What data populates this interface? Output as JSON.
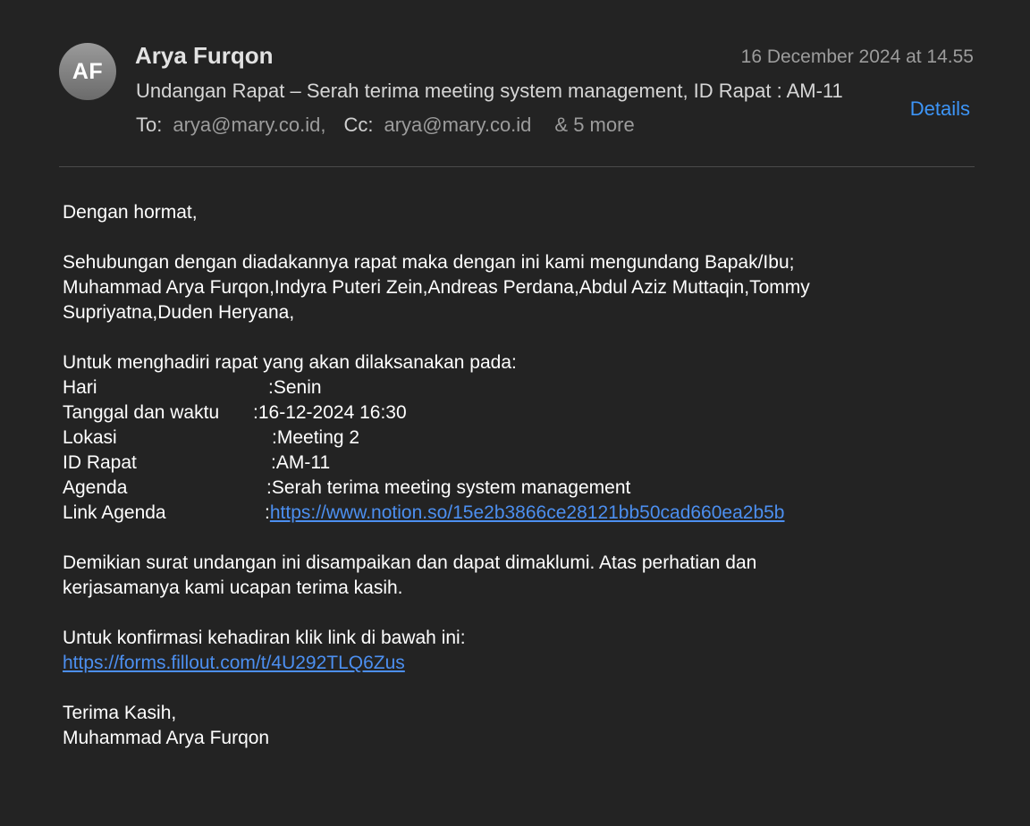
{
  "header": {
    "avatar_initials": "AF",
    "sender": "Arya Furqon",
    "date": "16 December 2024 at 14.55",
    "subject": "Undangan Rapat – Serah terima meeting system management, ID Rapat : AM-11",
    "to_label": "To:",
    "to_value": "arya@mary.co.id,",
    "cc_label": "Cc:",
    "cc_value": "arya@mary.co.id",
    "more": "& 5 more",
    "details_label": "Details"
  },
  "body": {
    "greeting": "Dengan hormat,",
    "intro_line1": "Sehubungan dengan diadakannya rapat maka dengan ini kami mengundang Bapak/Ibu;",
    "intro_line2": "Muhammad Arya Furqon,Indyra Puteri Zein,Andreas Perdana,Abdul Aziz Muttaqin,Tommy",
    "intro_line3": "Supriyatna,Duden Heryana,",
    "schedule_intro": "Untuk menghadiri rapat yang akan dilaksanakan pada:",
    "details": [
      {
        "key": "Hari",
        "sep": ": ",
        "value": "Senin"
      },
      {
        "key": "Tanggal dan waktu",
        "sep": ": ",
        "value": "16-12-2024 16:30"
      },
      {
        "key": "Lokasi",
        "sep": ": ",
        "value": "Meeting 2"
      },
      {
        "key": "ID Rapat",
        "sep": ": ",
        "value": "AM-11"
      },
      {
        "key": "Agenda",
        "sep": ": ",
        "value": "Serah terima meeting system management"
      },
      {
        "key": "Link Agenda",
        "sep": ": ",
        "value": "https://www.notion.so/15e2b3866ce28121bb50cad660ea2b5b"
      }
    ],
    "closing_line1": "Demikian surat undangan ini disampaikan dan dapat dimaklumi. Atas perhatian dan",
    "closing_line2": "kerjasamanya kami ucapan terima kasih.",
    "confirm_text": "Untuk konfirmasi kehadiran klik link di bawah ini:",
    "confirm_link": "https://forms.fillout.com/t/4U292TLQ6Zus",
    "signoff": "Terima Kasih,",
    "signature": "Muhammad Arya Furqon"
  },
  "colors": {
    "background": "#232323",
    "link": "#4c8ff0",
    "details_accent": "#3d95f7",
    "muted": "#9c9c9c"
  }
}
